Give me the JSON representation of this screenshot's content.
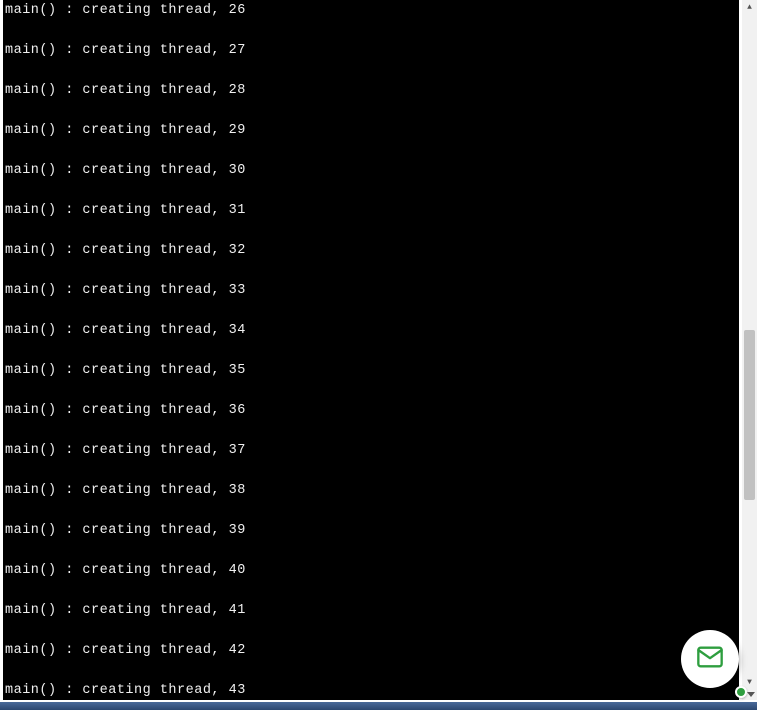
{
  "terminal": {
    "prefix": "main() : creating thread, ",
    "lines": [
      {
        "num": 26
      },
      {
        "num": 27
      },
      {
        "num": 28
      },
      {
        "num": 29
      },
      {
        "num": 30
      },
      {
        "num": 31
      },
      {
        "num": 32
      },
      {
        "num": 33
      },
      {
        "num": 34
      },
      {
        "num": 35
      },
      {
        "num": 36
      },
      {
        "num": 37
      },
      {
        "num": 38
      },
      {
        "num": 39
      },
      {
        "num": 40
      },
      {
        "num": 41
      },
      {
        "num": 42
      },
      {
        "num": 43
      }
    ]
  },
  "scroll": {
    "up_glyph": "▲",
    "down_glyph": "▼"
  },
  "fab": {
    "icon_name": "mail-icon",
    "icon_color": "#2e9e3f"
  }
}
